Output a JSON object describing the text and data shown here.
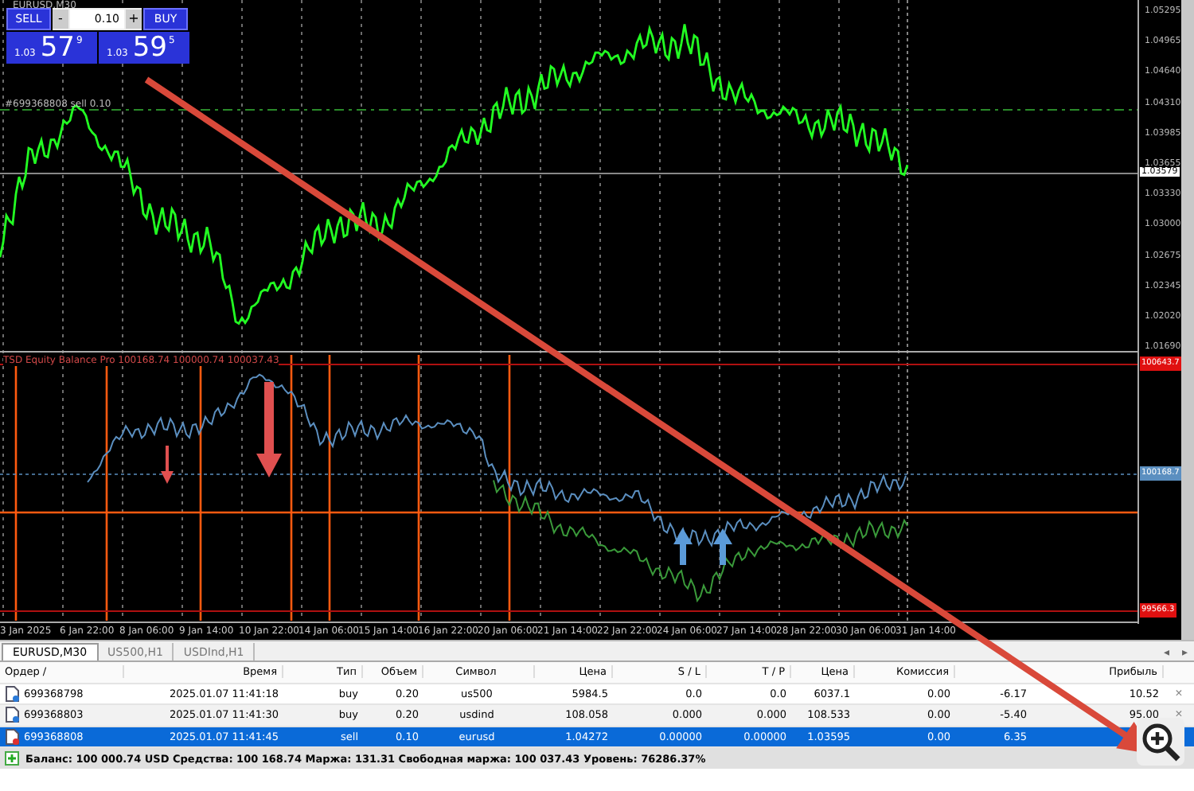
{
  "chart": {
    "symbol": "EURUSD,M30",
    "order_line": "#699368808 sell 0.10",
    "price_ticks": [
      "1.05295",
      "1.04965",
      "1.04640",
      "1.04310",
      "1.03985",
      "1.03655",
      "1.03330",
      "1.03000",
      "1.02675",
      "1.02345",
      "1.02020",
      "1.01690"
    ],
    "price_tag": "1.03579",
    "indicator_title": "TSD Equity Balance Pro  100168.74  100000.74  100037.43",
    "indicator_tags": [
      {
        "text": "100643.7",
        "color": "#e01010"
      },
      {
        "text": "100168.7",
        "color": "#5b8fc0"
      },
      {
        "text": "99566.3",
        "color": "#e01010"
      }
    ],
    "dates": [
      "3 Jan 2025",
      "6 Jan 22:00",
      "8 Jan 06:00",
      "9 Jan 14:00",
      "10 Jan 22:00",
      "14 Jan 06:00",
      "15 Jan 14:00",
      "16 Jan 22:00",
      "20 Jan 06:00",
      "21 Jan 14:00",
      "22 Jan 22:00",
      "24 Jan 06:00",
      "27 Jan 14:00",
      "28 Jan 22:00",
      "30 Jan 06:00",
      "31 Jan 14:00"
    ]
  },
  "trade_panel": {
    "sell_label": "SELL",
    "buy_label": "BUY",
    "minus": "-",
    "plus": "+",
    "volume": "0.10",
    "sell": {
      "small": "1.03",
      "big": "57",
      "sup": "9"
    },
    "buy": {
      "small": "1.03",
      "big": "59",
      "sup": "5"
    }
  },
  "tabs": [
    {
      "label": "EURUSD,M30",
      "selected": true
    },
    {
      "label": "US500,H1",
      "selected": false
    },
    {
      "label": "USDInd,H1",
      "selected": false
    }
  ],
  "tab_scroll": [
    "◂",
    "▸"
  ],
  "table": {
    "columns": [
      {
        "label": "Ордер  /"
      },
      {
        "label": "Время"
      },
      {
        "label": "Тип"
      },
      {
        "label": "Объем"
      },
      {
        "label": "Символ"
      },
      {
        "label": "Цена"
      },
      {
        "label": "S / L"
      },
      {
        "label": "T / P"
      },
      {
        "label": "Цена"
      },
      {
        "label": "Комиссия"
      },
      {},
      {
        "label": "Прибыль"
      }
    ],
    "rows": [
      {
        "selected": false,
        "cells": [
          "699368798",
          "2025.01.07 11:41:18",
          "buy",
          "0.20",
          "us500",
          "5984.5",
          "0.0",
          "0.0",
          "6037.1",
          "0.00",
          "-6.17",
          "10.52"
        ],
        "close": "×"
      },
      {
        "selected": false,
        "cells": [
          "699368803",
          "2025.01.07 11:41:30",
          "buy",
          "0.20",
          "usdind",
          "108.058",
          "0.000",
          "0.000",
          "108.533",
          "0.00",
          "-5.40",
          "95.00"
        ],
        "close": "×"
      },
      {
        "selected": true,
        "cells": [
          "699368808",
          "2025.01.07 11:41:45",
          "sell",
          "0.10",
          "eurusd",
          "1.04272",
          "0.00000",
          "0.00000",
          "1.03595",
          "0.00",
          "6.35"
        ]
      }
    ],
    "status": "Баланс: 100 000.74 USD  Средства: 100 168.74  Маржа: 131.31  Свободная маржа: 100 037.43  Уровень: 76286.37%"
  }
}
